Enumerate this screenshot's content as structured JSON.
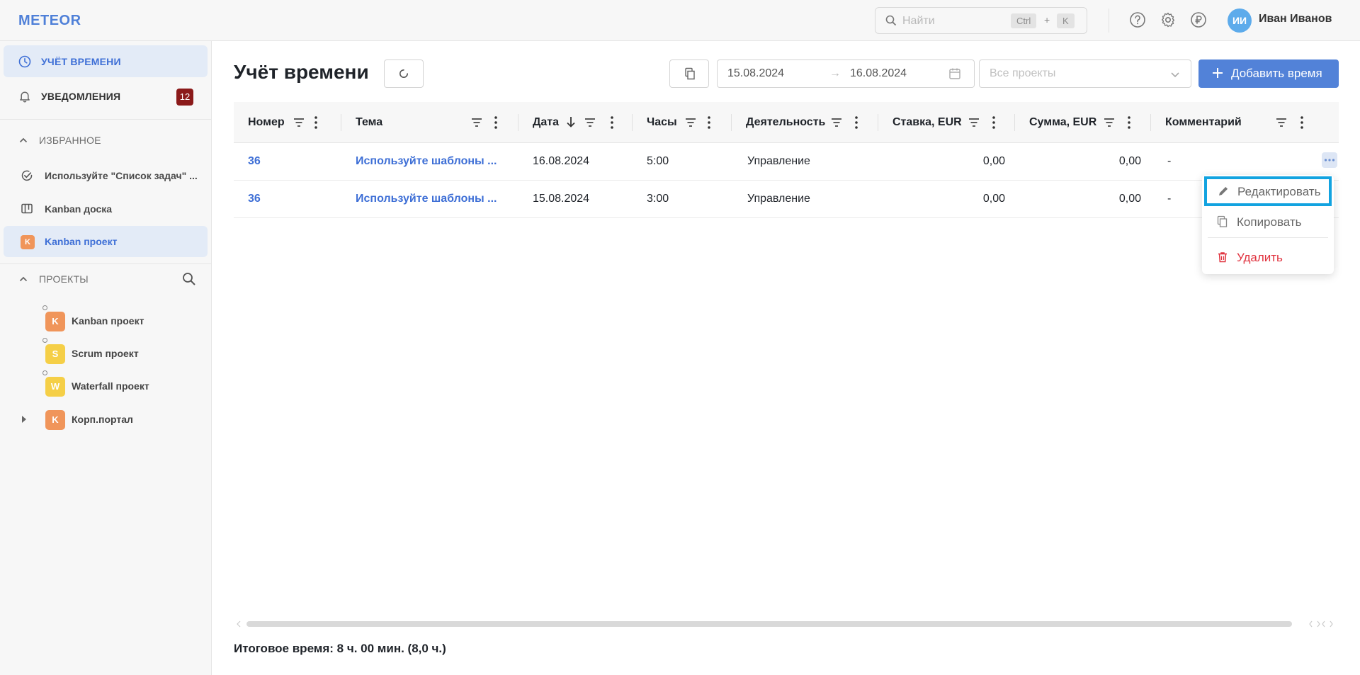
{
  "header": {
    "logo": "METEOR",
    "search": {
      "placeholder": "Найти",
      "kbd1": "Ctrl",
      "plus": "+",
      "kbd2": "K"
    },
    "user": {
      "initials": "ИИ",
      "name": "Иван Иванов"
    }
  },
  "sidebar": {
    "nav": [
      {
        "label": "УЧЁТ ВРЕМЕНИ",
        "icon": "clock-icon",
        "active": true
      },
      {
        "label": "УВЕДОМЛЕНИЯ",
        "icon": "bell-icon",
        "badge": "12"
      }
    ],
    "favorites_header": "ИЗБРАННОЕ",
    "favorites": [
      {
        "label": "Используйте \"Список задач\" ...",
        "icon": "check-circle-icon"
      },
      {
        "label": "Kanban доска",
        "icon": "kanban-board-icon"
      },
      {
        "label": "Kanban проект",
        "icon": "K",
        "active": true
      }
    ],
    "projects_header": "ПРОЕКТЫ",
    "projects": [
      {
        "letter": "K",
        "label": "Kanban проект",
        "color": "#f0955a"
      },
      {
        "letter": "S",
        "label": "Scrum проект",
        "color": "#f5cf47"
      },
      {
        "letter": "W",
        "label": "Waterfall проект",
        "color": "#f5cf47"
      },
      {
        "letter": "K",
        "label": "Корп.портал",
        "color": "#f0955a"
      }
    ]
  },
  "main": {
    "title": "Учёт времени",
    "date_from": "15.08.2024",
    "date_arrow": "→",
    "date_to": "16.08.2024",
    "project_placeholder": "Все проекты",
    "add_button": "Добавить время",
    "columns": [
      "Номер",
      "Тема",
      "Дата",
      "Часы",
      "Деятельность",
      "Ставка, EUR",
      "Сумма, EUR",
      "Комментарий"
    ],
    "rows": [
      {
        "number": "36",
        "topic": "Используйте шаблоны ...",
        "date": "16.08.2024",
        "hours": "5:00",
        "activity": "Управление",
        "rate": "0,00",
        "sum": "0,00",
        "comment": "-"
      },
      {
        "number": "36",
        "topic": "Используйте шаблоны ...",
        "date": "15.08.2024",
        "hours": "3:00",
        "activity": "Управление",
        "rate": "0,00",
        "sum": "0,00",
        "comment": "-"
      }
    ],
    "context_menu": {
      "edit": "Редактировать",
      "copy": "Копировать",
      "delete": "Удалить"
    },
    "total": "Итоговое время: 8 ч. 00 мин. (8,0 ч.)"
  },
  "colors": {
    "accent": "#5282d8",
    "link": "#3e6fd6",
    "danger": "#e0323e",
    "badge": "#8b1a1a",
    "highlight": "#12a3e0"
  }
}
